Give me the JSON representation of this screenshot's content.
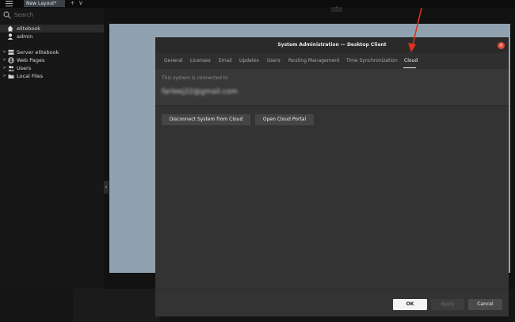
{
  "topbar": {
    "tab_label": "New Layout*",
    "plus_glyph": "+",
    "chevron_glyph": "∨",
    "handle_glyph": "˄"
  },
  "sidebar": {
    "search_placeholder": "Search",
    "items": [
      {
        "label": "elitebook",
        "icon": "home-icon"
      },
      {
        "label": "admin",
        "icon": "user-icon"
      },
      {
        "label": "Server elitebook",
        "icon": "server-icon"
      },
      {
        "label": "Web Pages",
        "icon": "globe-icon"
      },
      {
        "label": "Users",
        "icon": "users-icon"
      },
      {
        "label": "Local Files",
        "icon": "folder-icon"
      }
    ],
    "expand_glyph": ">",
    "collapse_glyph": "‹"
  },
  "dialog": {
    "title": "System Administration — Desktop Client",
    "close_glyph": "×",
    "tabs": [
      "General",
      "Licenses",
      "Email",
      "Updates",
      "Users",
      "Routing Management",
      "Time Synchronization",
      "Cloud"
    ],
    "active_tab": "Cloud",
    "info_text": "This system is connected to",
    "email_blurred": "farleej22@gmail.com",
    "buttons": {
      "disconnect": "Disconnect System from Cloud",
      "portal": "Open Cloud Portal",
      "ok": "OK",
      "apply": "Apply",
      "cancel": "Cancel"
    }
  },
  "colors": {
    "accent_close": "#e04b3a",
    "annotation_arrow": "#e0301e",
    "layout_background": "#90a2b0"
  }
}
